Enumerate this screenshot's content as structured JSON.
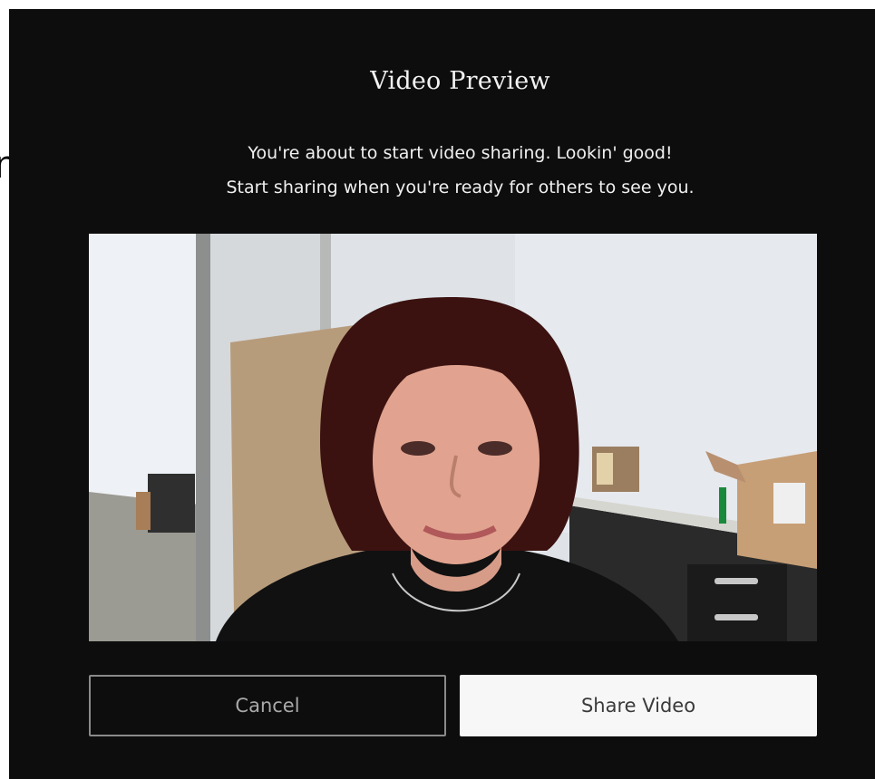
{
  "background": {
    "fragment_glyph": "n"
  },
  "modal": {
    "title": "Video Preview",
    "description_line1": "You're about to start video sharing. Lookin' good!",
    "description_line2": "Start sharing when you're ready for others to see you.",
    "cancel_label": "Cancel",
    "share_label": "Share Video",
    "colors": {
      "modal_bg": "#0d0d0d",
      "text": "#f0f0f0",
      "cancel_border": "#8a8a8a",
      "share_bg": "#f7f7f7"
    }
  }
}
